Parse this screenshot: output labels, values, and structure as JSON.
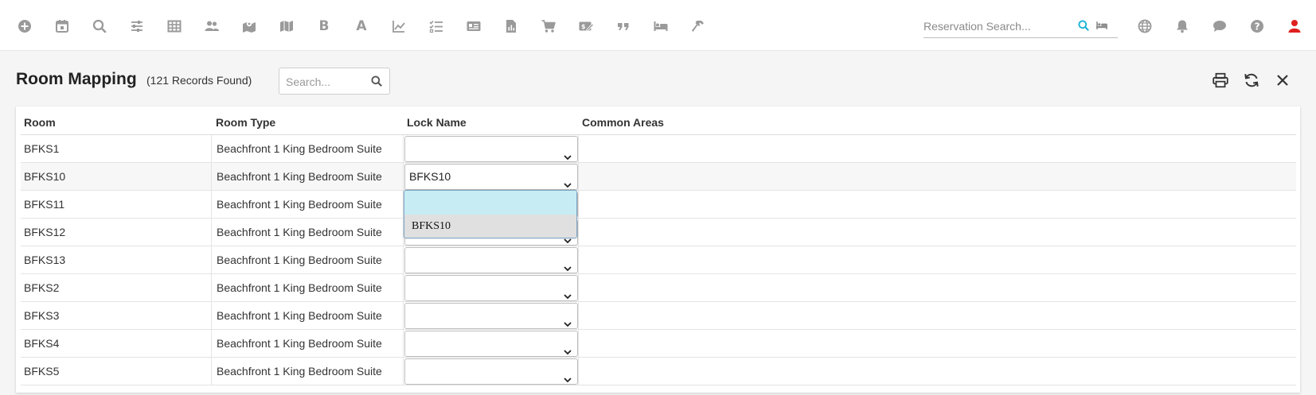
{
  "toolbar": {
    "icons": [
      "add-circle-icon",
      "calendar-icon",
      "search-icon",
      "sliders-icon",
      "table-icon",
      "users-icon",
      "map-pin-icon",
      "map-icon",
      "bold-icon",
      "font-icon",
      "line-chart-icon",
      "checklist-icon",
      "id-card-icon",
      "report-icon",
      "cart-icon",
      "pos-icon",
      "quote-icon",
      "bed-icon",
      "hammer-icon"
    ],
    "bold_letter": "B",
    "font_letter": "A",
    "reservation_search_placeholder": "Reservation Search..."
  },
  "header": {
    "title": "Room Mapping",
    "records": "(121 Records Found)",
    "search_placeholder": "Search..."
  },
  "table": {
    "columns": [
      "Room",
      "Room Type",
      "Lock Name",
      "Common Areas"
    ],
    "rows": [
      {
        "room": "BFKS1",
        "type": "Beachfront 1 King Bedroom Suite",
        "lock": ""
      },
      {
        "room": "BFKS10",
        "type": "Beachfront 1 King Bedroom Suite",
        "lock": "BFKS10"
      },
      {
        "room": "BFKS11",
        "type": "Beachfront 1 King Bedroom Suite",
        "lock": ""
      },
      {
        "room": "BFKS12",
        "type": "Beachfront 1 King Bedroom Suite",
        "lock": ""
      },
      {
        "room": "BFKS13",
        "type": "Beachfront 1 King Bedroom Suite",
        "lock": ""
      },
      {
        "room": "BFKS2",
        "type": "Beachfront 1 King Bedroom Suite",
        "lock": ""
      },
      {
        "room": "BFKS3",
        "type": "Beachfront 1 King Bedroom Suite",
        "lock": ""
      },
      {
        "room": "BFKS4",
        "type": "Beachfront 1 King Bedroom Suite",
        "lock": ""
      },
      {
        "room": "BFKS5",
        "type": "Beachfront 1 King Bedroom Suite",
        "lock": ""
      }
    ]
  },
  "dropdown": {
    "options": [
      "",
      "BFKS10"
    ]
  },
  "colors": {
    "accent": "#19b3d6",
    "profile": "#e02020",
    "highlight": "#c7ecf3"
  }
}
